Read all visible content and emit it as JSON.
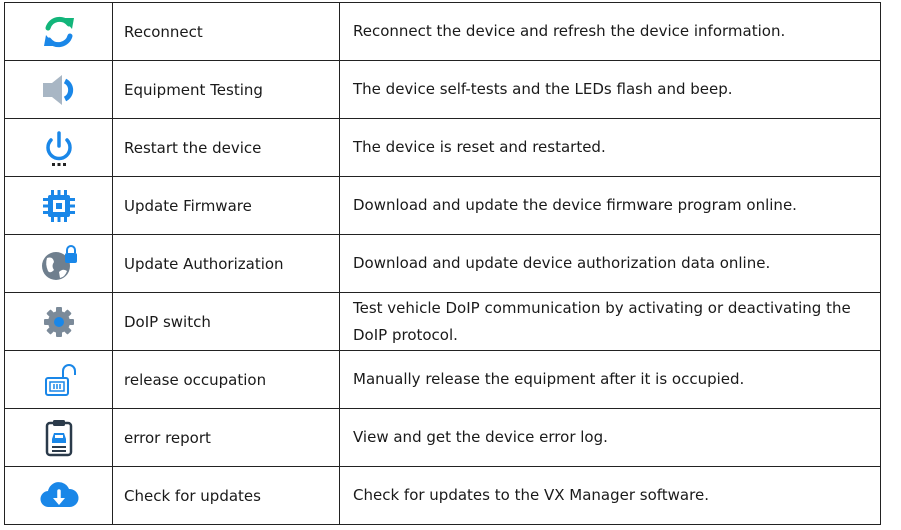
{
  "colors": {
    "blue": "#1a87e8",
    "green": "#12b57a",
    "gray": "#7b8a99"
  },
  "rows": [
    {
      "icon": "reconnect-icon",
      "name": "Reconnect",
      "desc": "Reconnect the device and refresh the device information."
    },
    {
      "icon": "speaker-icon",
      "name": "Equipment Testing",
      "desc": "The device self-tests and the LEDs flash and beep."
    },
    {
      "icon": "power-icon",
      "name": "Restart the device",
      "desc": "The device is reset and restarted."
    },
    {
      "icon": "chip-icon",
      "name": "Update Firmware",
      "desc": "Download and update the device firmware program online."
    },
    {
      "icon": "globe-lock-icon",
      "name": "Update Authorization",
      "desc": "Download and update device authorization data online."
    },
    {
      "icon": "gear-icon",
      "name": "DoIP switch",
      "desc": "Test vehicle DoIP communication by activating or deactivating the DoIP protocol."
    },
    {
      "icon": "unlock-icon",
      "name": "release occupation",
      "desc": "Manually release the equipment after it is occupied."
    },
    {
      "icon": "clipboard-report-icon",
      "name": "error report",
      "desc": "View and get the device error log."
    },
    {
      "icon": "cloud-download-icon",
      "name": "Check for updates",
      "desc": "Check for updates to the VX Manager software."
    }
  ]
}
